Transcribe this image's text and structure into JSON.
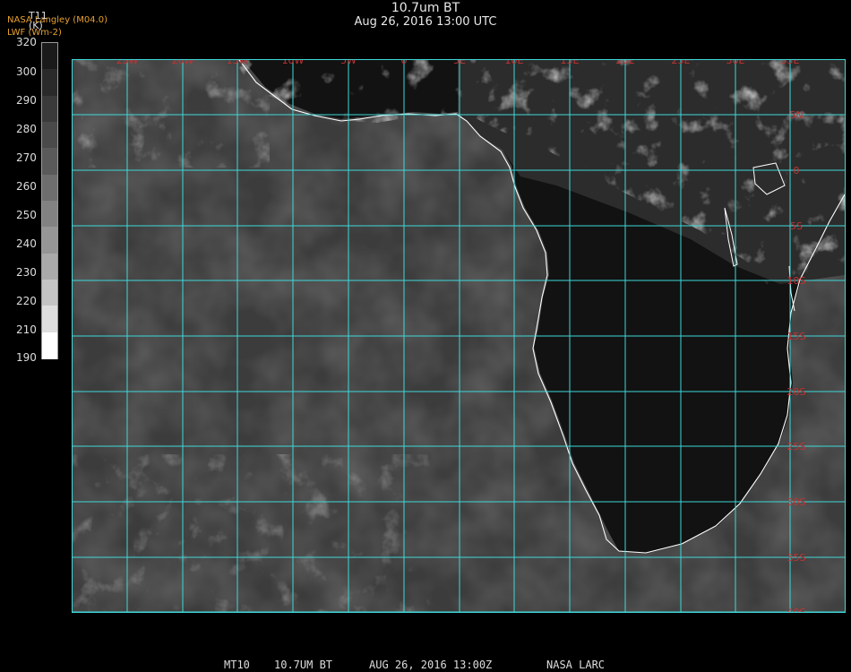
{
  "header": {
    "title": "10.7um BT",
    "subtitle": "Aug 26, 2016 13:00 UTC",
    "credit_line1": "NASA Langley (M04.0)",
    "credit_line2": "LWF (Wm-2)"
  },
  "legend": {
    "title": "T11",
    "unit": "(K)",
    "ticks": [
      "320",
      "300",
      "290",
      "280",
      "270",
      "260",
      "250",
      "240",
      "230",
      "220",
      "210",
      "190"
    ],
    "colors": [
      "#1a1a1a",
      "#2a2a2a",
      "#3a3a3a",
      "#4a4a4a",
      "#5a5a5a",
      "#6e6e6e",
      "#828282",
      "#969696",
      "#aaaaaa",
      "#c4c4c4",
      "#dedede",
      "#ffffff"
    ]
  },
  "map": {
    "lon_labels": [
      "25W",
      "20W",
      "15W",
      "10W",
      "5W",
      "0",
      "5E",
      "10E",
      "15E",
      "20E",
      "25E",
      "30E",
      "35E"
    ],
    "lat_labels": [
      "5N",
      "0",
      "5S",
      "10S",
      "15S",
      "20S",
      "25S",
      "30S",
      "35S",
      "40S"
    ],
    "grid_color": "#3fd8d8",
    "label_color": "#c83030"
  },
  "footer": {
    "product": "MT10",
    "channel": "10.7UM BT",
    "datetime": "AUG 26, 2016 13:00Z",
    "source": "NASA LARC"
  }
}
